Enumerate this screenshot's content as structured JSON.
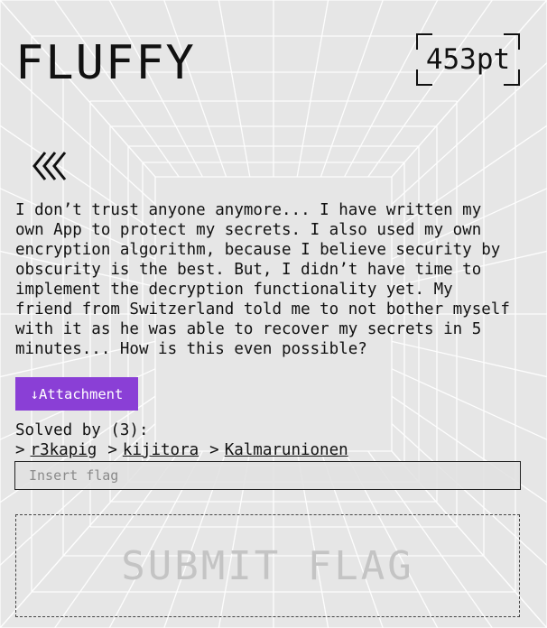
{
  "challenge": {
    "title": "FLUFFY",
    "points": "453pt",
    "description": "I don’t trust anyone anymore... I have written my\nown App to protect my secrets. I also used my own\nencryption algorithm, because I believe security by\nobscurity is the best. But, I didn’t have time to\nimplement the decryption functionality yet. My\nfriend from Switzerland told me to not bother myself\nwith it as he was able to recover my secrets in 5\nminutes... How is this even possible?",
    "attachment_label": "↓Attachment",
    "solved_by_label": "Solved by (3):",
    "solvers": [
      {
        "marker": ">",
        "name": "r3kapig"
      },
      {
        "marker": ">",
        "name": "kijitora"
      },
      {
        "marker": ">",
        "name": "Kalmarunionen"
      }
    ],
    "flag_placeholder": "Insert flag",
    "submit_label": "SUBMIT FLAG"
  },
  "icons": {
    "back": "triple-chevron-left-icon"
  },
  "colors": {
    "background": "#e6e6e6",
    "accent": "#8a3fd6",
    "text": "#111111",
    "submit_text": "#c4c4c4"
  }
}
